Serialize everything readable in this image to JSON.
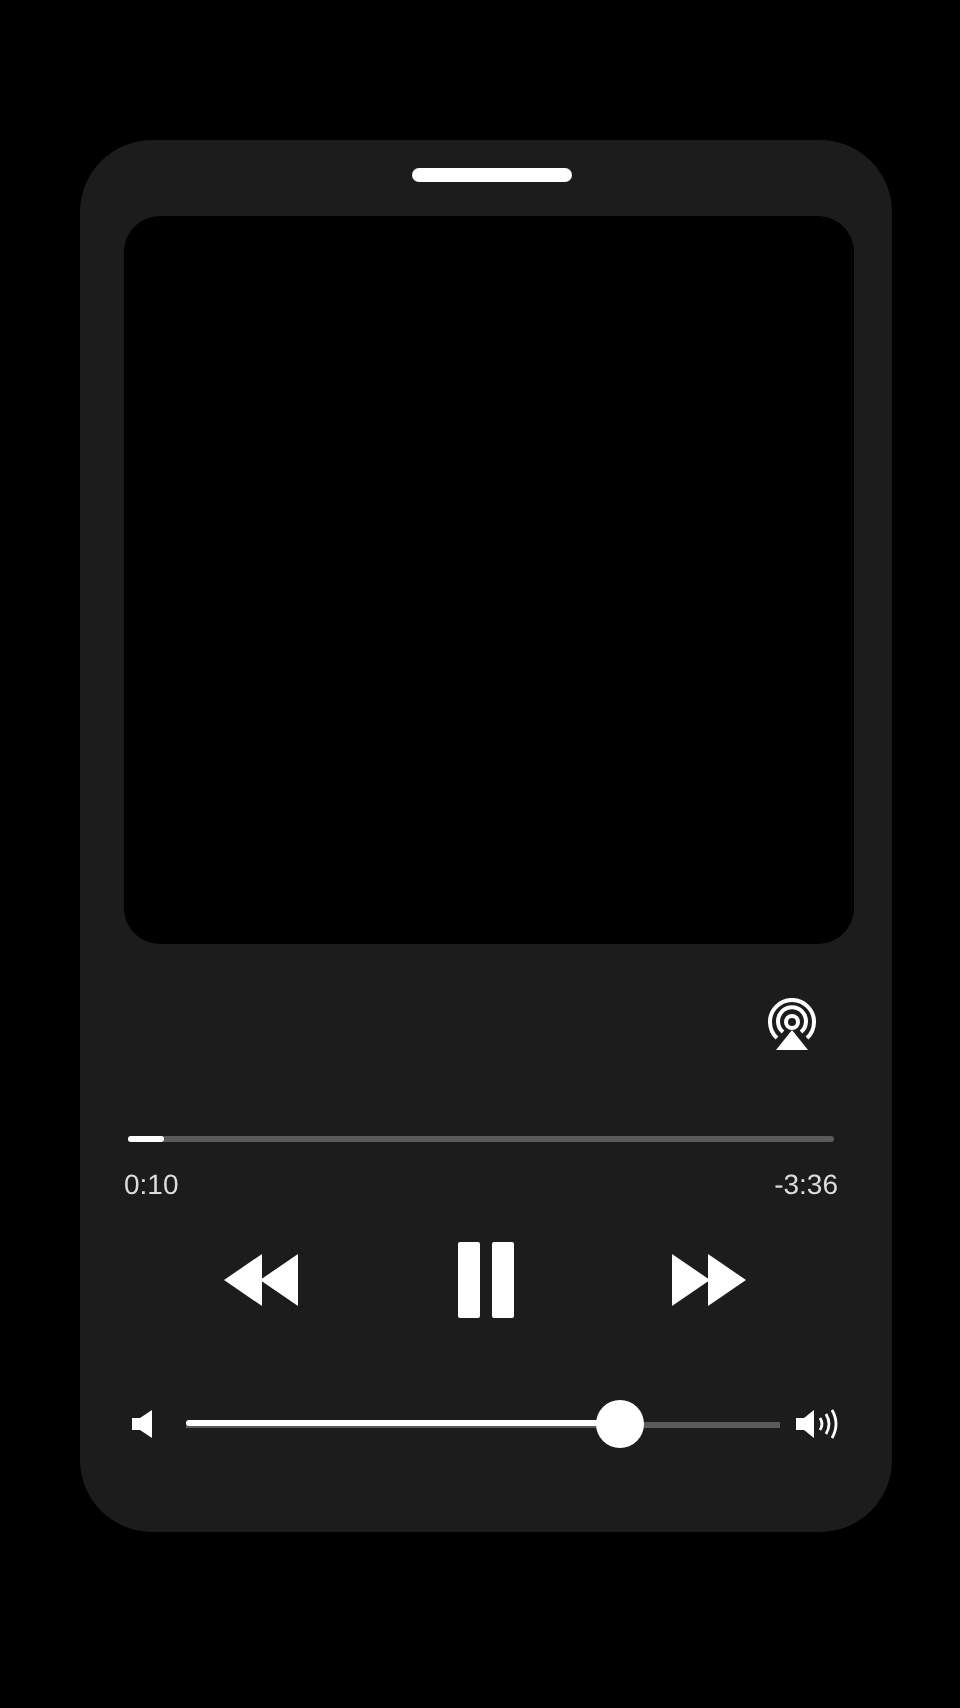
{
  "player": {
    "playing": true,
    "progress": {
      "level": 0.05,
      "elapsed": "0:10",
      "remaining": "-3:36"
    },
    "volume": {
      "level": 0.73
    }
  }
}
